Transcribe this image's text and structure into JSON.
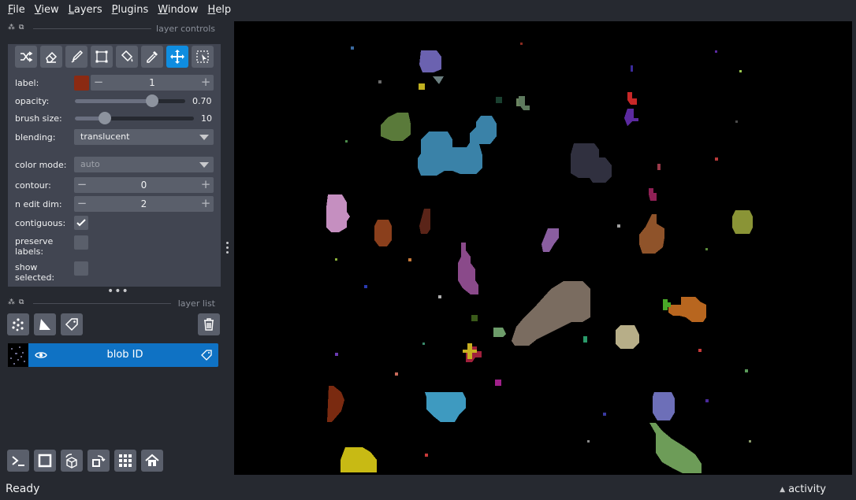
{
  "menubar": {
    "items": [
      {
        "first": "F",
        "rest": "ile"
      },
      {
        "first": "V",
        "rest": "iew"
      },
      {
        "first": "L",
        "rest": "ayers"
      },
      {
        "first": "P",
        "rest": "lugins"
      },
      {
        "first": "W",
        "rest": "indow"
      },
      {
        "first": "H",
        "rest": "elp"
      }
    ]
  },
  "layer_controls": {
    "title": "layer controls",
    "modes": [
      "shuffle-icon",
      "eraser-icon",
      "paint-brush-icon",
      "polygon-transform-icon",
      "fill-bucket-icon",
      "color-picker-icon",
      "pan-zoom-icon",
      "select-icon"
    ],
    "active_mode": "pan-zoom-icon",
    "label": {
      "caption": "label:",
      "value": "1",
      "swatch_color": "#8b2a12"
    },
    "opacity": {
      "caption": "opacity:",
      "value": "0.70",
      "fraction": 0.7
    },
    "brush_size": {
      "caption": "brush size:",
      "value": "10",
      "fraction": 0.25
    },
    "blending": {
      "caption": "blending:",
      "value": "translucent"
    },
    "color_mode": {
      "caption": "color mode:",
      "value": "auto"
    },
    "contour": {
      "caption": "contour:",
      "value": "0"
    },
    "n_edit_dim": {
      "caption": "n edit dim:",
      "value": "2"
    },
    "contiguous": {
      "caption": "contiguous:",
      "checked": true
    },
    "preserve_labels": {
      "caption_1": "preserve",
      "caption_2": "labels:",
      "checked": false
    },
    "show_selected": {
      "caption_1": "show",
      "caption_2": "selected:",
      "checked": false
    }
  },
  "layer_list": {
    "title": "layer list",
    "layers": [
      {
        "name": "blob ID",
        "visible": true,
        "selected": true
      }
    ]
  },
  "colors": {
    "accent": "#0f8de0",
    "selected_layer": "#0f72c4",
    "panel": "#414551",
    "background": "#262930"
  },
  "status": {
    "text": "Ready",
    "activity": "activity"
  }
}
